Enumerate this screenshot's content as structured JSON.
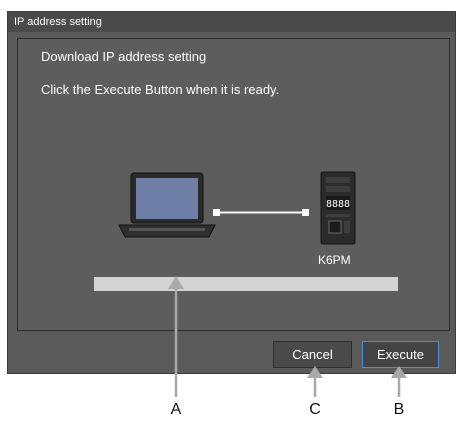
{
  "dialog": {
    "title": "IP address setting",
    "instruction_heading": "Download IP address setting",
    "instruction_text": "Click the Execute Button when it is ready.",
    "device_label": "K6PM",
    "device_display": "8888",
    "progress": 0,
    "buttons": {
      "cancel": "Cancel",
      "execute": "Execute"
    }
  },
  "callouts": {
    "a": "A",
    "b": "B",
    "c": "C"
  },
  "colors": {
    "dialog_bg": "#5a5a5a",
    "titlebar_bg": "#4a4a4a",
    "progress_track": "#d4d4d4",
    "execute_border": "#4b8fd6"
  }
}
